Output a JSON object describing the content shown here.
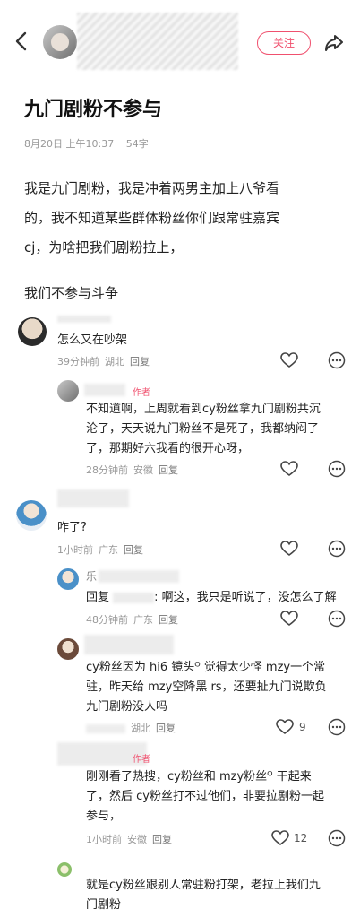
{
  "header": {
    "back_icon": "chevron-left-icon",
    "follow_label": "关注",
    "share_icon": "share-icon"
  },
  "post": {
    "title": "九门剧粉不参与",
    "date": "8月20日 上午10:37",
    "views": "54字",
    "body_line1": "我是九门剧粉，我是冲着两男主加上八爷看",
    "body_line2": "的，我不知道某些群体粉丝你们跟常驻嘉宾",
    "body_line3": "cj，为啥把我们剧粉拉上，",
    "body_para2": "我们不参与斗争"
  },
  "comments": [
    {
      "text": "怎么又在吵架",
      "time": "39分钟前",
      "location": "湖北",
      "reply_label": "回复"
    },
    {
      "author_tag": "作者",
      "line1": "不知道啊，上周就看到cy粉丝拿九门剧粉共沉",
      "line2": "沦了，天天说九门粉丝不是死了，我都纳闷了",
      "line3": "了，那期好六我看的很开心呀，",
      "time": "28分钟前",
      "location": "安徽",
      "reply_label": "回复"
    },
    {
      "text": "咋了?",
      "time": "1小时前",
      "location": "广东",
      "reply_label": "回复"
    },
    {
      "name_fragment": "乐",
      "text": "回复 ",
      "text2": ": 啊这，我只是听说了，没怎么了解",
      "time": "48分钟前",
      "location": "广东",
      "reply_label": "回复"
    },
    {
      "line1": "cy粉丝因为 hi6 镜头ᴼ 觉得太少怪 mzy一个常",
      "line2": "驻，昨天给 mzy空降黑 rs，还要扯九门说欺负",
      "line3": "九门剧粉没人吗",
      "time": "",
      "location": "湖北",
      "reply_label": "回复",
      "likes": "9"
    },
    {
      "author_tag": "作者",
      "line1": "刚刚看了热搜，cy粉丝和 mzy粉丝ᴼ 干起来",
      "line2": "了，然后 cy粉丝打不过他们，非要拉剧粉一起",
      "line3": "参与，",
      "time": "1小时前",
      "location": "安徽",
      "reply_label": "回复",
      "likes": "12"
    },
    {
      "line1": "就是cy粉丝跟别人常驻粉打架，老拉上我们九",
      "line2": "门剧粉"
    }
  ],
  "colors": {
    "accent": "#f0506e",
    "meta": "#999999"
  }
}
